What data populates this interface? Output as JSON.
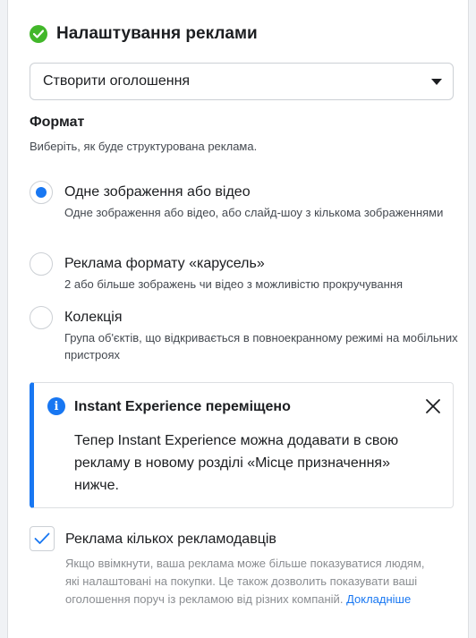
{
  "header": {
    "title": "Налаштування реклами",
    "check_icon": "check-circle-icon",
    "check_color": "#42b72a"
  },
  "dropdown": {
    "value": "Створити оголошення",
    "caret_icon": "caret-down-icon"
  },
  "format": {
    "title": "Формат",
    "subtitle": "Виберіть, як буде структурована реклама.",
    "options": [
      {
        "label": "Одне зображення або відео",
        "description": "Одне зображення або відео, або слайд-шоу з кількома зображеннями",
        "selected": true
      },
      {
        "label": "Реклама формату «карусель»",
        "description": "2 або більше зображень чи відео з можливістю прокручування",
        "selected": false
      },
      {
        "label": "Колекція",
        "description": "Група об'єктів, що відкривається в повноекранному режимі на мобільних пристроях",
        "selected": false
      }
    ]
  },
  "notice": {
    "title": "Instant Experience переміщено",
    "body": "Тепер Instant Experience можна додавати в свою рекламу в новому розділі «Місце призначення» нижче.",
    "info_icon": "info-icon",
    "close_icon": "close-icon",
    "accent_color": "#1877f2"
  },
  "multi_advertiser": {
    "label": "Реклама кількох рекламодавців",
    "description": "Якщо ввімкнути, ваша реклама може більше показуватися людям, які налаштовані на покупки. Це також дозволить показувати ваші оголошення поруч із рекламою від різних компаній.",
    "link_text": "Докладніше",
    "checked": true
  }
}
